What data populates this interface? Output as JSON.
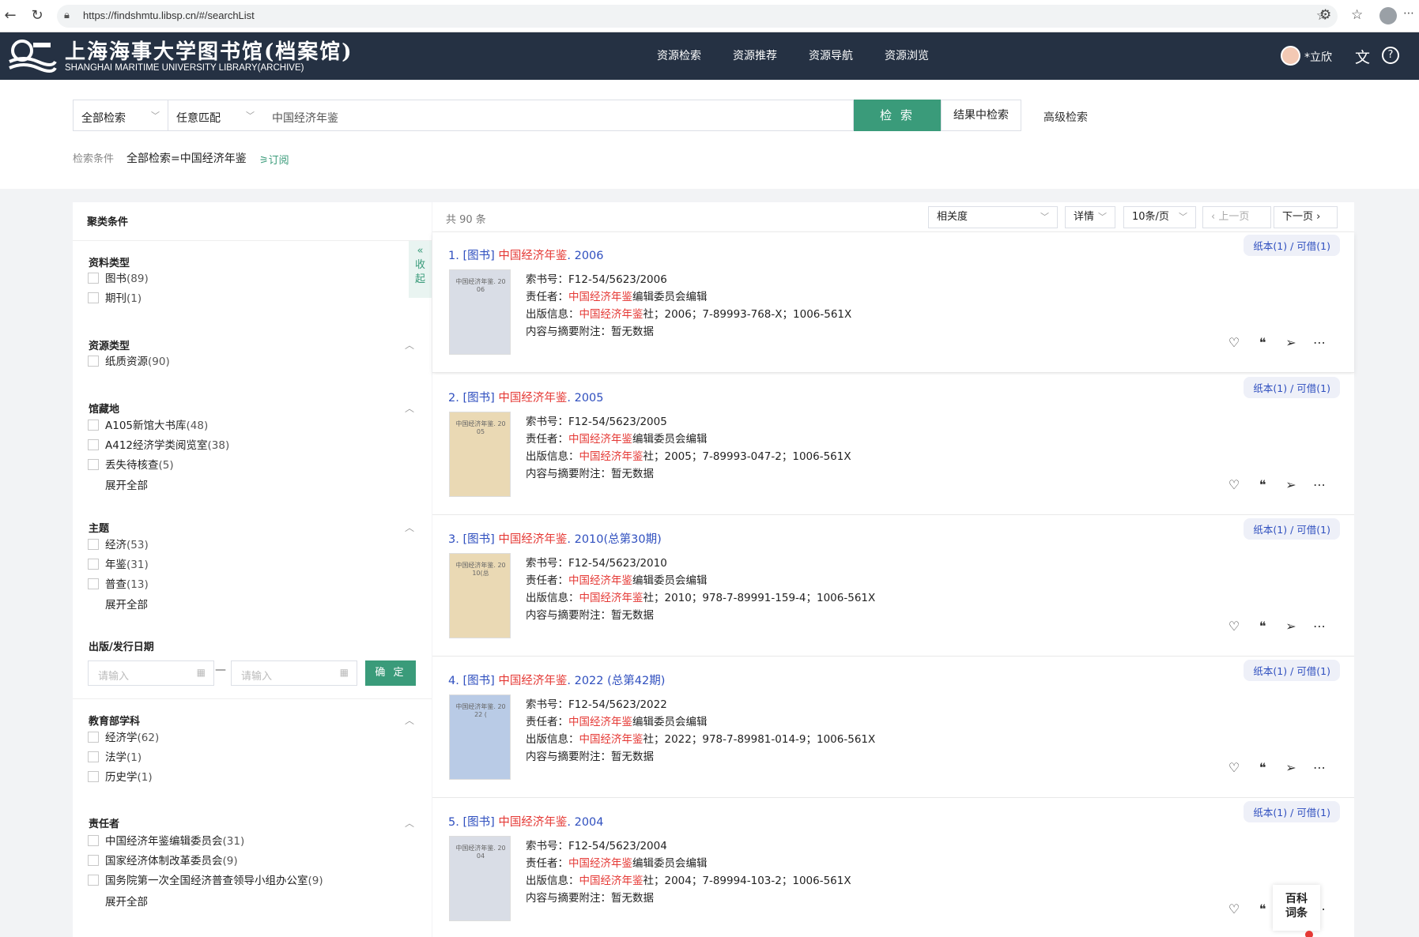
{
  "browser": {
    "url": "https://findshmtu.libsp.cn/#/searchList",
    "back_icon": "arrow-left",
    "reload_icon": "reload",
    "lock_icon": "lock",
    "bookmark_icon": "star",
    "more_icon": "ellipsis"
  },
  "header": {
    "logo_cn": "上海海事大学图书馆(档案馆)",
    "logo_en": "SHANGHAI MARITIME UNIVERSITY LIBRARY(ARCHIVE)",
    "menu": [
      "资源检索",
      "资源推荐",
      "资源导航",
      "资源浏览"
    ],
    "user_name": "*立欣",
    "bg_color": "#253143"
  },
  "search": {
    "scope": "全部检索",
    "match": "任意匹配",
    "query": "中国经济年鉴",
    "search_button": "检 索",
    "within_button": "结果中检索",
    "advanced": "高级检索",
    "condition_label": "检索条件",
    "condition_value": "全部检索=中国经济年鉴",
    "subscribe": "订阅",
    "accent_color": "#3a9b7a"
  },
  "facets": {
    "title": "聚类条件",
    "collapse": [
      "收",
      "起"
    ],
    "sections": [
      {
        "title": "资料类型",
        "options": [
          {
            "label": "图书",
            "count": "(89)"
          },
          {
            "label": "期刊",
            "count": "(1)"
          }
        ]
      },
      {
        "title": "资源类型",
        "options": [
          {
            "label": "纸质资源",
            "count": "(90)"
          }
        ]
      },
      {
        "title": "馆藏地",
        "options": [
          {
            "label": "A105新馆大书库",
            "count": "(48)"
          },
          {
            "label": "A412经济学类阅览室",
            "count": "(38)"
          },
          {
            "label": "丢失待核查",
            "count": "(5)"
          }
        ],
        "expand": "展开全部"
      },
      {
        "title": "主题",
        "options": [
          {
            "label": "经济",
            "count": "(53)"
          },
          {
            "label": "年鉴",
            "count": "(31)"
          },
          {
            "label": "普查",
            "count": "(13)"
          }
        ],
        "expand": "展开全部"
      },
      {
        "title": "教育部学科",
        "options": [
          {
            "label": "经济学",
            "count": "(62)"
          },
          {
            "label": "法学",
            "count": "(1)"
          },
          {
            "label": "历史学",
            "count": "(1)"
          }
        ]
      },
      {
        "title": "责任者",
        "options": [
          {
            "label": "中国经济年鉴编辑委员会",
            "count": "(31)"
          },
          {
            "label": "国家经济体制改革委员会",
            "count": "(9)"
          },
          {
            "label": "国务院第一次全国经济普查领导小组办公室",
            "count": "(9)"
          }
        ],
        "expand": "展开全部"
      }
    ],
    "date": {
      "title": "出版/发行日期",
      "placeholder": "请输入",
      "dash": "—",
      "confirm": "确 定"
    }
  },
  "results_bar": {
    "total": "共 90 条",
    "sort": "相关度",
    "view": "详情",
    "page_size": "10条/页",
    "prev": "上一页",
    "next": "下一页"
  },
  "results": [
    {
      "num": "1.",
      "type": "[图书]",
      "title": "中国经济年鉴",
      "suffix": ". 2006",
      "cover_text": "中国经济年鉴. 20 06",
      "cover_bg": "#d9dde6",
      "call_no": "F12-54/5623/2006",
      "author_rest": "编辑委员会编辑",
      "publisher_rest": "社；2006；7-89993-768-X；1006-561X",
      "abstract": "暂无数据",
      "avail": "纸本(1) / 可借(1)"
    },
    {
      "num": "2.",
      "type": "[图书]",
      "title": "中国经济年鉴",
      "suffix": ". 2005",
      "cover_text": "中国经济年鉴. 20 05",
      "cover_bg": "#ead9b4",
      "call_no": "F12-54/5623/2005",
      "author_rest": "编辑委员会编辑",
      "publisher_rest": "社；2005；7-89993-047-2；1006-561X",
      "abstract": "暂无数据",
      "avail": "纸本(1) / 可借(1)"
    },
    {
      "num": "3.",
      "type": "[图书]",
      "title": "中国经济年鉴",
      "suffix": ". 2010(总第30期)",
      "cover_text": "中国经济年鉴. 20 10(总",
      "cover_bg": "#ead9b4",
      "call_no": "F12-54/5623/2010",
      "author_rest": "编辑委员会编辑",
      "publisher_rest": "社；2010；978-7-89991-159-4；1006-561X",
      "abstract": "暂无数据",
      "avail": "纸本(1) / 可借(1)"
    },
    {
      "num": "4.",
      "type": "[图书]",
      "title": "中国经济年鉴",
      "suffix": ". 2022 (总第42期)",
      "cover_text": "中国经济年鉴. 20 22 (",
      "cover_bg": "#b9cbe6",
      "call_no": "F12-54/5623/2022",
      "author_rest": "编辑委员会编辑",
      "publisher_rest": "社；2022；978-7-89981-014-9；1006-561X",
      "abstract": "暂无数据",
      "avail": "纸本(1) / 可借(1)"
    },
    {
      "num": "5.",
      "type": "[图书]",
      "title": "中国经济年鉴",
      "suffix": ". 2004",
      "cover_text": "中国经济年鉴. 20 04",
      "cover_bg": "#d9dde6",
      "call_no": "F12-54/5623/2004",
      "author_rest": "编辑委员会编辑",
      "publisher_rest": "社；2004；7-89994-103-2；1006-561X",
      "abstract": "暂无数据",
      "avail": "纸本(1) / 可借(1)"
    }
  ],
  "labels": {
    "call_no": "索书号：",
    "author": "责任者：",
    "publisher": "出版信息：",
    "abstract": "内容与摘要附注：",
    "author_hl": "中国经济年鉴",
    "publisher_hl": "中国经济年鉴"
  },
  "float_widget": [
    "百科",
    "词条"
  ]
}
